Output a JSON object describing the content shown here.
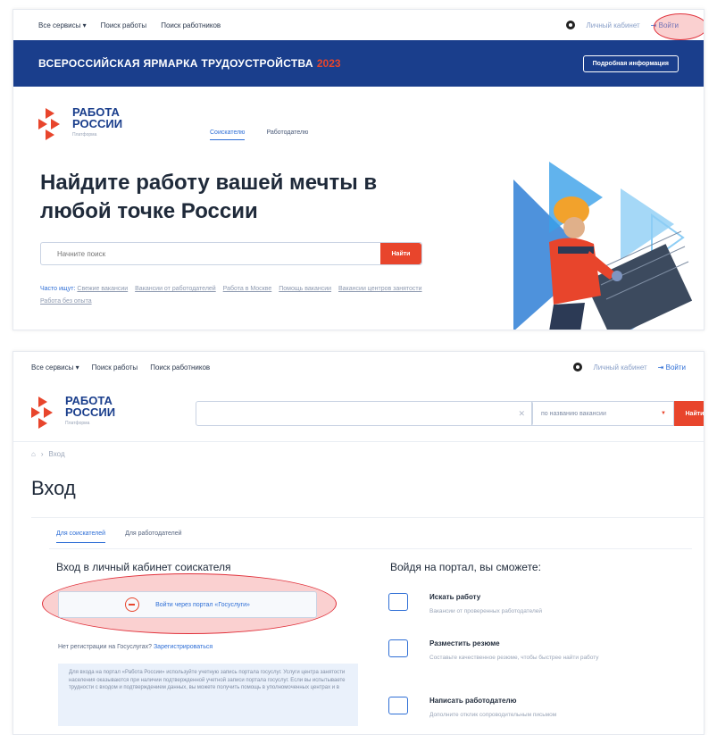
{
  "top": {
    "nav": {
      "services": "Все сервисы ▾",
      "job_search": "Поиск работы",
      "employee_search": "Поиск работников",
      "personal_account": "Личный кабинет",
      "login": "Войти"
    },
    "banner": {
      "title": "ВСЕРОССИЙСКАЯ ЯРМАРКА ТРУДОУСТРОЙСТВА",
      "year": "2023",
      "button": "Подробная информация"
    },
    "logo": {
      "line1": "РАБОТА",
      "line2": "РОССИИ",
      "sub": "Платформа"
    },
    "role_tabs": [
      "Соискателю",
      "Работодателю"
    ],
    "hero_title": "Найдите работу вашей мечты в любой точке России",
    "search": {
      "placeholder": "Начните поиск",
      "button": "Найти"
    },
    "often_label": "Часто ищут:",
    "often_items": [
      "Свежие вакансии",
      "Вакансии от работодателей",
      "Работа в Москве",
      "Помощь вакансии",
      "Вакансии центров занятости",
      "Работа без опыта"
    ]
  },
  "bottom": {
    "nav": {
      "services": "Все сервисы ▾",
      "job_search": "Поиск работы",
      "employee_search": "Поиск работников",
      "personal_account": "Личный кабинет",
      "login": "Войти"
    },
    "logo": {
      "line1": "РАБОТА",
      "line2": "РОССИИ",
      "sub": "Платформа"
    },
    "search": {
      "placeholder": "",
      "select": "по названию вакансии",
      "button": "Найти"
    },
    "breadcrumb": "Вход",
    "page_title": "Вход",
    "tabs": [
      "Для соискателей",
      "Для работодателей"
    ],
    "login_heading": "Вход в личный кабинет соискателя",
    "gos_button": "Войти через портал «Госуслуги»",
    "noreg_text": "Нет регистрации на Госуслугах?",
    "noreg_link": "Зарегистрироваться",
    "info_text": "Для входа на портал «Работа России» используйте учетную запись портала госуслуг. Услуги центра занятости населения оказываются при наличии подтвержденной учетной записи портала госуслуг. Если вы испытываете трудности с входом и подтверждением данных, вы можете получить помощь в уполномоченных центрах и в",
    "benefits_heading": "Войдя на портал, вы сможете:",
    "benefits": [
      {
        "title": "Искать работу",
        "desc": "Вакансии от проверенных работодателей"
      },
      {
        "title": "Разместить резюме",
        "desc": "Составьте качественное резюме, чтобы быстрее найти работу"
      },
      {
        "title": "Написать работодателю",
        "desc": "Дополните отклик сопроводительным письмом"
      }
    ]
  },
  "colors": {
    "brand_blue": "#1a3e8c",
    "accent_red": "#e8452c",
    "link_blue": "#2f6fd6",
    "highlight": "#e0303a"
  }
}
